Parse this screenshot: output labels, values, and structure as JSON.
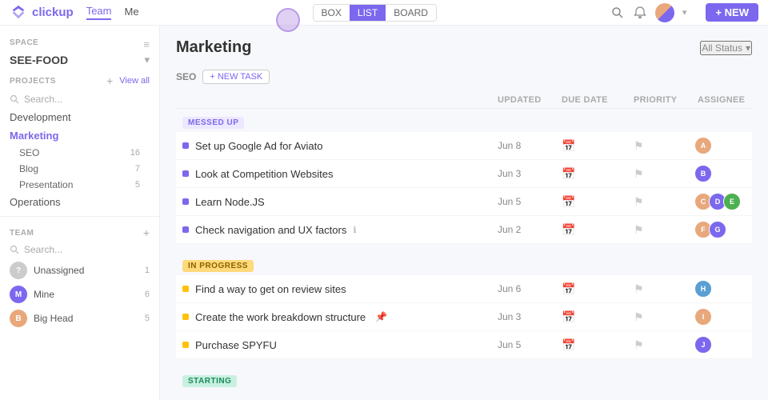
{
  "brand": {
    "name": "clickup",
    "logo_unicode": "🏠"
  },
  "topnav": {
    "links": [
      {
        "label": "Team",
        "active": true
      },
      {
        "label": "Me",
        "active": false
      }
    ],
    "views": [
      {
        "label": "BOX",
        "active": false
      },
      {
        "label": "LIST",
        "active": true
      },
      {
        "label": "BOARD",
        "active": false
      }
    ],
    "new_button": "+ NEW"
  },
  "sidebar": {
    "space_label": "SPACE",
    "space_name": "SEE-FOOD",
    "projects_label": "PROJECTS",
    "view_all": "View all",
    "search_placeholder": "Search...",
    "nav_items": [
      {
        "label": "Development",
        "active": false
      },
      {
        "label": "Marketing",
        "active": true
      }
    ],
    "sub_items": [
      {
        "label": "SEO",
        "count": 16
      },
      {
        "label": "Blog",
        "count": 7
      },
      {
        "label": "Presentation",
        "count": 5
      }
    ],
    "operations": {
      "label": "Operations"
    },
    "team_label": "TEAM",
    "team_items": [
      {
        "label": "Unassigned",
        "count": 1,
        "color": "#ccc"
      },
      {
        "label": "Mine",
        "count": 6,
        "color": "#7b68ee"
      },
      {
        "label": "Big Head",
        "count": 5,
        "color": "#e8a87c"
      }
    ]
  },
  "content": {
    "title": "Marketing",
    "all_status": "All Status",
    "seo_section": "SEO",
    "new_task_btn": "+ NEW TASK",
    "table_headers": {
      "updated": "UPDATED",
      "due_date": "DUE DATE",
      "priority": "PRIORITY",
      "assignee": "ASSIGNEE"
    },
    "sections": [
      {
        "id": "messed-up",
        "label": "MESSED UP",
        "status_class": "status-messed-up",
        "tasks": [
          {
            "name": "Set up Google Ad for Aviato",
            "updated": "Jun 8",
            "dot": "purple"
          },
          {
            "name": "Look at Competition Websites",
            "updated": "Jun 3",
            "dot": "purple"
          },
          {
            "name": "Learn Node.JS",
            "updated": "Jun 5",
            "dot": "purple"
          },
          {
            "name": "Check navigation and UX factors",
            "updated": "Jun 2",
            "dot": "purple",
            "has_info": true
          }
        ]
      },
      {
        "id": "in-progress",
        "label": "IN PROGRESS",
        "status_class": "status-in-progress",
        "tasks": [
          {
            "name": "Find a way to get on review sites",
            "updated": "Jun 6",
            "dot": "yellow"
          },
          {
            "name": "Create the work breakdown structure",
            "updated": "Jun 3",
            "dot": "yellow",
            "has_pin": true
          },
          {
            "name": "Purchase SPYFU",
            "updated": "Jun 5",
            "dot": "yellow"
          }
        ]
      },
      {
        "id": "starting",
        "label": "STARTING",
        "status_class": "status-starting",
        "tasks": []
      }
    ]
  }
}
